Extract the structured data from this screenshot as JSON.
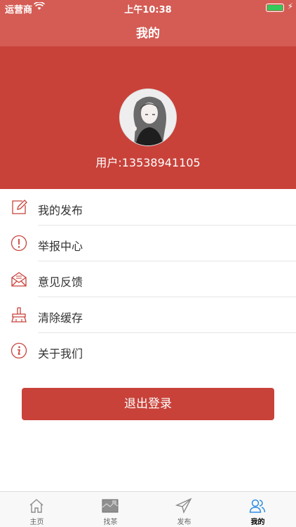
{
  "status": {
    "carrier": "运营商",
    "time": "上午10:38"
  },
  "nav": {
    "title": "我的"
  },
  "profile": {
    "username": "用户:13538941105"
  },
  "menu": [
    {
      "label": "我的发布",
      "icon": "edit-icon"
    },
    {
      "label": "举报中心",
      "icon": "alert-icon"
    },
    {
      "label": "意见反馈",
      "icon": "mail-icon"
    },
    {
      "label": "清除缓存",
      "icon": "broom-icon"
    },
    {
      "label": "关于我们",
      "icon": "info-icon"
    }
  ],
  "logout_label": "退出登录",
  "tabs": [
    {
      "label": "主页",
      "icon": "home-icon"
    },
    {
      "label": "找茶",
      "icon": "map-icon"
    },
    {
      "label": "发布",
      "icon": "send-icon"
    },
    {
      "label": "我的",
      "icon": "user-icon",
      "active": true
    }
  ],
  "colors": {
    "nav": "#d45c54",
    "accent": "#c8423a",
    "tab_active": "#2f8de4"
  }
}
